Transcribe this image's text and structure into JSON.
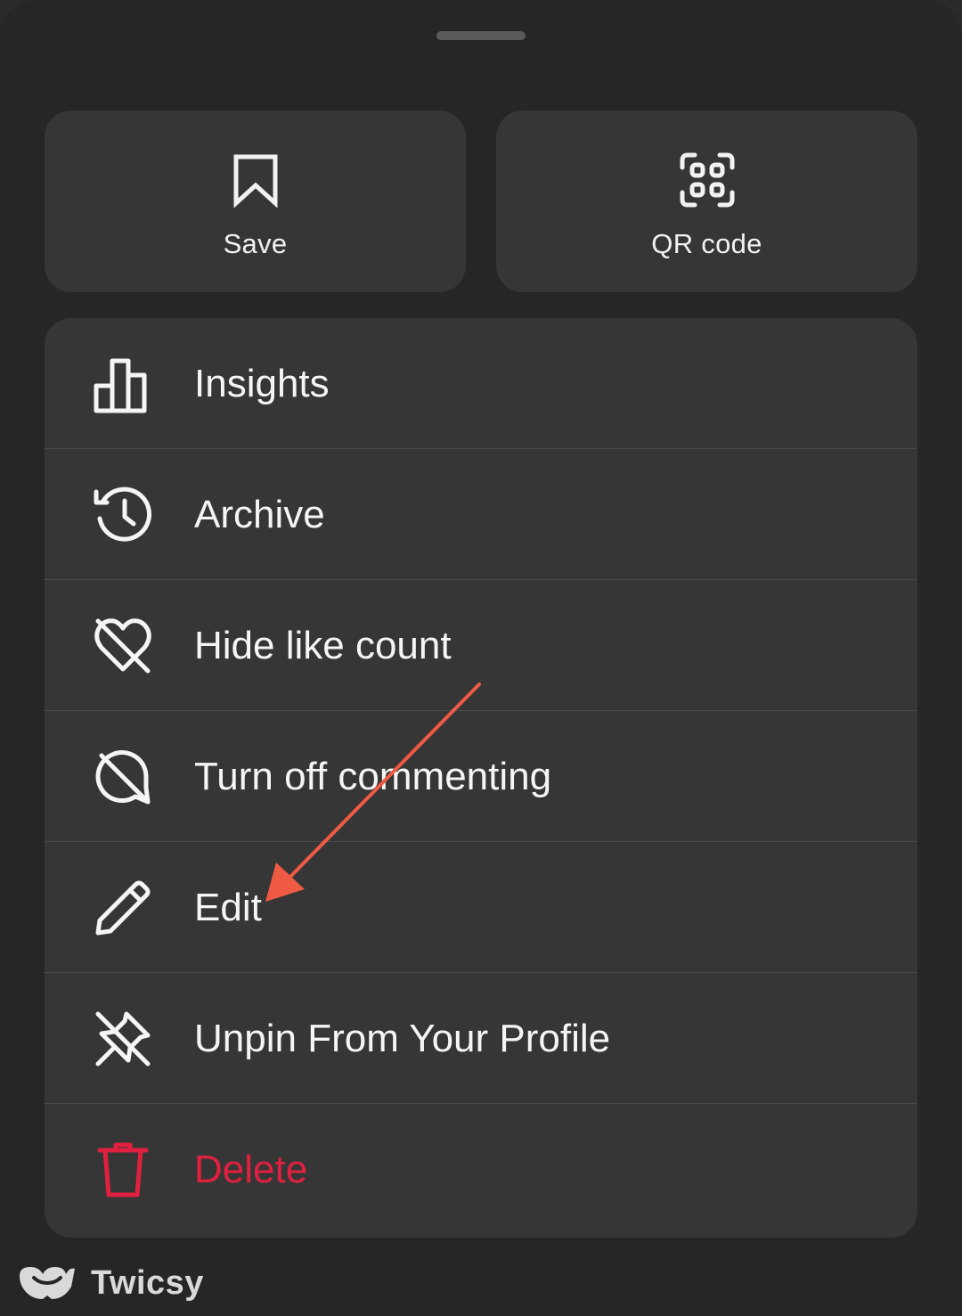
{
  "sheet": {
    "grabber_icon": "grabber-handle"
  },
  "tiles": [
    {
      "label": "Save",
      "icon": "bookmark-icon"
    },
    {
      "label": "QR code",
      "icon": "qr-code-icon"
    }
  ],
  "menu": {
    "items": [
      {
        "label": "Insights",
        "icon": "bar-chart-icon"
      },
      {
        "label": "Archive",
        "icon": "history-clock-icon"
      },
      {
        "label": "Hide like count",
        "icon": "heart-slash-icon"
      },
      {
        "label": "Turn off commenting",
        "icon": "comment-slash-icon"
      },
      {
        "label": "Edit",
        "icon": "pencil-icon"
      },
      {
        "label": "Unpin From Your Profile",
        "icon": "pin-slash-icon"
      },
      {
        "label": "Delete",
        "icon": "trash-icon"
      }
    ]
  },
  "watermark": {
    "name": "Twicsy"
  },
  "colors": {
    "background": "#262626",
    "card": "#363636",
    "text": "#f5f5f5",
    "danger": "#e0203e",
    "annotation_arrow": "#ef5a44"
  }
}
